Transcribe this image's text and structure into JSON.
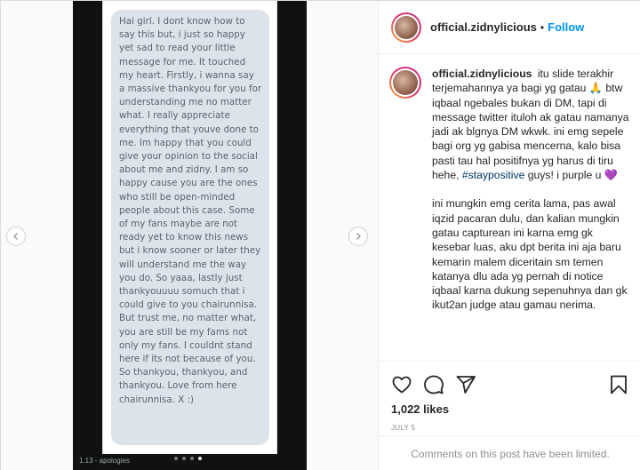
{
  "media": {
    "message_text": "Hai girl. I dont know how to say this but, i just so happy yet sad to read your little message for me. It touched my heart. Firstly, i wanna say a massive thankyou for you for understanding me no matter what. I really appreciate everything that youve done to me. Im happy that you could give your opinion to the social about me and zidny. I am so happy cause you are the ones who still be open-minded people about this case. Some of my fans maybe are not ready yet to know this news but i know sooner or later they will understand me the way you do. So yaaa, lastly just thankyouuuu somuch that i could give to you chairunnisa. But trust me, no matter what, you are still be my fams not only my fans. I couldnt stand here if its not because of you. So thankyou, thankyou, and thankyou. Love from here chairunnisa. X :)",
    "caption": "1.13 - apologies",
    "carousel": {
      "count": 4,
      "active_index": 3
    }
  },
  "header": {
    "username": "official.zidnylicious",
    "separator": "•",
    "follow_label": "Follow"
  },
  "comment": {
    "username": "official.zidnylicious",
    "text_part1": "itu slide terakhir terjemahannya ya bagi yg gatau 🙏 btw iqbaal ngebales bukan di DM, tapi di message twitter ituloh ak gatau namanya jadi ak blgnya DM wkwk. ini emg sepele bagi org yg gabisa mencerna, kalo bisa pasti tau hal positifnya yg harus di tiru hehe,",
    "hashtag": "#staypositive",
    "text_part2": "guys! i purple u",
    "heart": "💜",
    "paragraph2": "ini mungkin emg cerita lama, pas awal iqzid pacaran dulu, dan kalian mungkin gatau capturean ini karna emg gk kesebar luas, aku dpt berita ini aja baru kemarin malem diceritain sm temen katanya dlu ada yg pernah di notice iqbaal karna dukung sepenuhnya dan gk ikut2an judge atau gamau nerima."
  },
  "stats": {
    "likes": "1,022 likes",
    "date": "JULY 5"
  },
  "footer": {
    "limited_text": "Comments on this post have been limited."
  },
  "icons": [
    "chevron-left-icon",
    "chevron-right-icon",
    "heart-icon",
    "comment-icon",
    "share-icon",
    "bookmark-icon"
  ]
}
